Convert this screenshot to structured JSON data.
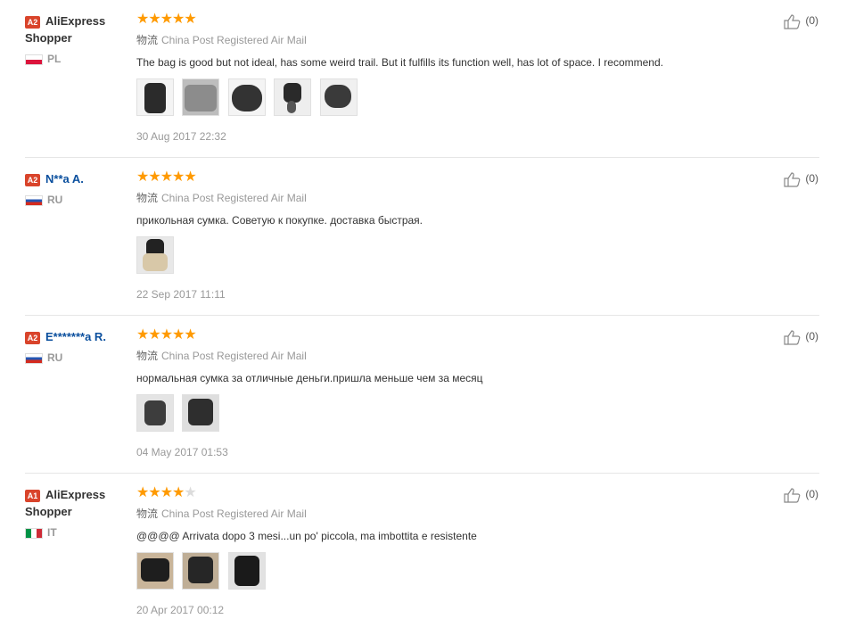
{
  "reviews": [
    {
      "badge": "A2",
      "name": "AliExpress Shopper",
      "name_link": false,
      "country": "PL",
      "flag": "pl",
      "rating": 5,
      "shipping_cn": "物流",
      "shipping": "China Post Registered Air Mail",
      "comment": "The bag is good but not ideal, has some weird trail. But it fulfills its function well, has lot of space. I recommend.",
      "photo_count": 5,
      "date": "30 Aug 2017 22:32",
      "helpful": "(0)"
    },
    {
      "badge": "A2",
      "name": "N**a A.",
      "name_link": true,
      "country": "RU",
      "flag": "ru",
      "rating": 5,
      "shipping_cn": "物流",
      "shipping": "China Post Registered Air Mail",
      "comment": "прикольная сумка. Советую к покупке. доставка быстрая.",
      "photo_count": 1,
      "date": "22 Sep 2017 11:11",
      "helpful": "(0)"
    },
    {
      "badge": "A2",
      "name": "E*******a R.",
      "name_link": true,
      "country": "RU",
      "flag": "ru",
      "rating": 5,
      "shipping_cn": "物流",
      "shipping": "China Post Registered Air Mail",
      "comment": "нормальная сумка за отличные деньги.пришла меньше чем за месяц",
      "photo_count": 2,
      "date": "04 May 2017 01:53",
      "helpful": "(0)"
    },
    {
      "badge": "A1",
      "name": "AliExpress Shopper",
      "name_link": false,
      "country": "IT",
      "flag": "it",
      "rating": 4,
      "shipping_cn": "物流",
      "shipping": "China Post Registered Air Mail",
      "comment": "@@@@ Arrivata dopo 3 mesi...un po' piccola, ma imbottita e resistente",
      "photo_count": 3,
      "date": "20 Apr 2017 00:12",
      "helpful": "(0)"
    }
  ],
  "colors": {
    "star": "#ff9a00",
    "star_empty": "#dcdcdc",
    "badge": "#d9442b",
    "link": "#0a4f9e"
  },
  "icons": {
    "helpful": "thumbs-up-icon",
    "star": "star-icon"
  }
}
